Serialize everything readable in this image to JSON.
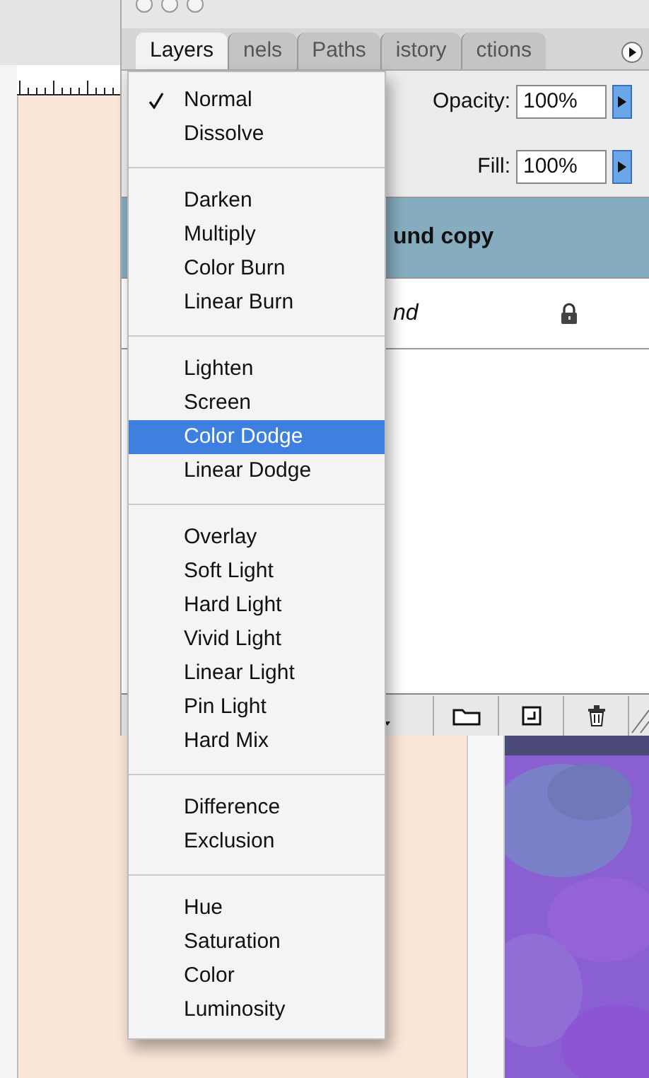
{
  "panel": {
    "tabs": [
      {
        "label": "Layers",
        "selected": true
      },
      {
        "label": "nels",
        "selected": false
      },
      {
        "label": "Paths",
        "selected": false
      },
      {
        "label": "istory",
        "selected": false
      },
      {
        "label": "ctions",
        "selected": false
      }
    ],
    "opacity": {
      "label": "Opacity:",
      "value": "100%"
    },
    "fill": {
      "label": "Fill:",
      "value": "100%"
    },
    "layers": [
      {
        "name": "und copy",
        "kind": "layer",
        "selected": true,
        "locked": false
      },
      {
        "name": "nd",
        "kind": "background",
        "selected": false,
        "locked": true
      }
    ]
  },
  "blend_menu": {
    "groups": [
      [
        {
          "label": "Normal",
          "checked": true,
          "selected": false
        },
        {
          "label": "Dissolve",
          "checked": false,
          "selected": false
        }
      ],
      [
        {
          "label": "Darken",
          "checked": false,
          "selected": false
        },
        {
          "label": "Multiply",
          "checked": false,
          "selected": false
        },
        {
          "label": "Color Burn",
          "checked": false,
          "selected": false
        },
        {
          "label": "Linear Burn",
          "checked": false,
          "selected": false
        }
      ],
      [
        {
          "label": "Lighten",
          "checked": false,
          "selected": false
        },
        {
          "label": "Screen",
          "checked": false,
          "selected": false
        },
        {
          "label": "Color Dodge",
          "checked": false,
          "selected": true
        },
        {
          "label": "Linear Dodge",
          "checked": false,
          "selected": false
        }
      ],
      [
        {
          "label": "Overlay",
          "checked": false,
          "selected": false
        },
        {
          "label": "Soft Light",
          "checked": false,
          "selected": false
        },
        {
          "label": "Hard Light",
          "checked": false,
          "selected": false
        },
        {
          "label": "Vivid Light",
          "checked": false,
          "selected": false
        },
        {
          "label": "Linear Light",
          "checked": false,
          "selected": false
        },
        {
          "label": "Pin Light",
          "checked": false,
          "selected": false
        },
        {
          "label": "Hard Mix",
          "checked": false,
          "selected": false
        }
      ],
      [
        {
          "label": "Difference",
          "checked": false,
          "selected": false
        },
        {
          "label": "Exclusion",
          "checked": false,
          "selected": false
        }
      ],
      [
        {
          "label": "Hue",
          "checked": false,
          "selected": false
        },
        {
          "label": "Saturation",
          "checked": false,
          "selected": false
        },
        {
          "label": "Color",
          "checked": false,
          "selected": false
        },
        {
          "label": "Luminosity",
          "checked": false,
          "selected": false
        }
      ]
    ]
  }
}
